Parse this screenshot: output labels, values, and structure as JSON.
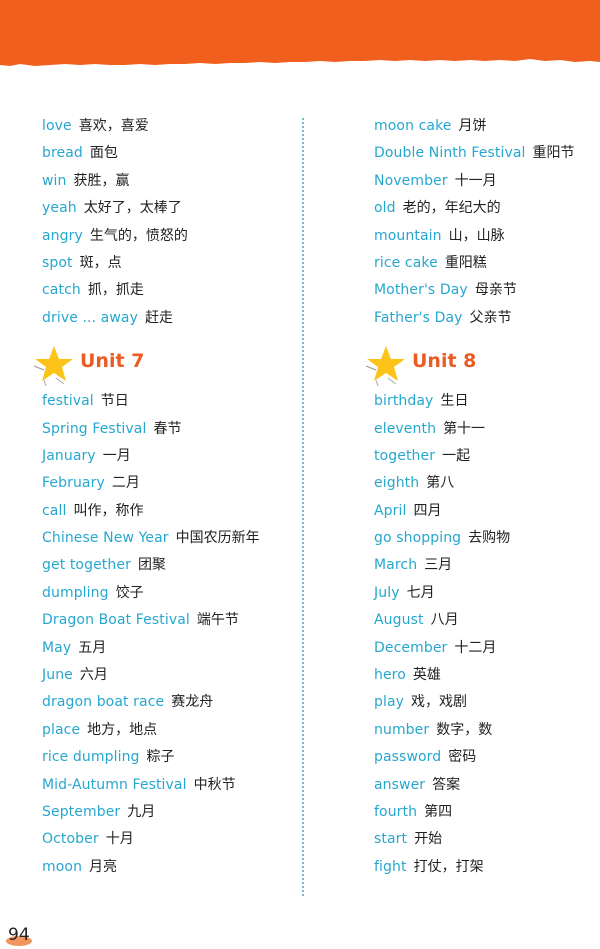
{
  "page": {
    "page_number": "94",
    "accent_color": "#f15f1e",
    "english_color": "#26a7cf",
    "unit_heading_color": "#ec5b24"
  },
  "left_column": {
    "intro_entries": [
      {
        "en": "love",
        "zh": "喜欢，喜爱"
      },
      {
        "en": "bread",
        "zh": "面包"
      },
      {
        "en": "win",
        "zh": "获胜，赢"
      },
      {
        "en": "yeah",
        "zh": "太好了，太棒了"
      },
      {
        "en": "angry",
        "zh": "生气的，愤怒的"
      },
      {
        "en": "spot",
        "zh": "斑，点"
      },
      {
        "en": "catch",
        "zh": "抓，抓走"
      },
      {
        "en": "drive ... away",
        "zh": "赶走"
      }
    ],
    "unit": {
      "title": "Unit 7",
      "entries": [
        {
          "en": "festival",
          "zh": "节日"
        },
        {
          "en": "Spring Festival",
          "zh": "春节"
        },
        {
          "en": "January",
          "zh": "一月"
        },
        {
          "en": "February",
          "zh": "二月"
        },
        {
          "en": "call",
          "zh": "叫作，称作"
        },
        {
          "en": "Chinese New Year",
          "zh": "中国农历新年"
        },
        {
          "en": "get together",
          "zh": "团聚"
        },
        {
          "en": "dumpling",
          "zh": "饺子"
        },
        {
          "en": "Dragon Boat Festival",
          "zh": "端午节"
        },
        {
          "en": "May",
          "zh": "五月"
        },
        {
          "en": "June",
          "zh": "六月"
        },
        {
          "en": "dragon boat race",
          "zh": "赛龙舟"
        },
        {
          "en": "place",
          "zh": "地方，地点"
        },
        {
          "en": "rice dumpling",
          "zh": "粽子"
        },
        {
          "en": "Mid-Autumn Festival",
          "zh": "中秋节"
        },
        {
          "en": "September",
          "zh": "九月"
        },
        {
          "en": "October",
          "zh": "十月"
        },
        {
          "en": "moon",
          "zh": "月亮"
        }
      ]
    }
  },
  "right_column": {
    "intro_entries": [
      {
        "en": "moon cake",
        "zh": "月饼"
      },
      {
        "en": "Double Ninth Festival",
        "zh": "重阳节"
      },
      {
        "en": "November",
        "zh": "十一月"
      },
      {
        "en": "old",
        "zh": "老的，年纪大的"
      },
      {
        "en": "mountain",
        "zh": "山，山脉"
      },
      {
        "en": "rice cake",
        "zh": "重阳糕"
      },
      {
        "en": "Mother's Day",
        "zh": "母亲节"
      },
      {
        "en": "Father's Day",
        "zh": "父亲节"
      }
    ],
    "unit": {
      "title": "Unit 8",
      "entries": [
        {
          "en": "birthday",
          "zh": "生日"
        },
        {
          "en": "eleventh",
          "zh": "第十一"
        },
        {
          "en": "together",
          "zh": "一起"
        },
        {
          "en": "eighth",
          "zh": "第八"
        },
        {
          "en": "April",
          "zh": "四月"
        },
        {
          "en": "go shopping",
          "zh": "去购物"
        },
        {
          "en": "March",
          "zh": "三月"
        },
        {
          "en": "July",
          "zh": "七月"
        },
        {
          "en": "August",
          "zh": "八月"
        },
        {
          "en": "December",
          "zh": "十二月"
        },
        {
          "en": "hero",
          "zh": "英雄"
        },
        {
          "en": "play",
          "zh": "戏，戏剧"
        },
        {
          "en": "number",
          "zh": "数字，数"
        },
        {
          "en": "password",
          "zh": "密码"
        },
        {
          "en": "answer",
          "zh": "答案"
        },
        {
          "en": "fourth",
          "zh": "第四"
        },
        {
          "en": "start",
          "zh": "开始"
        },
        {
          "en": "fight",
          "zh": "打仗，打架"
        }
      ]
    }
  }
}
